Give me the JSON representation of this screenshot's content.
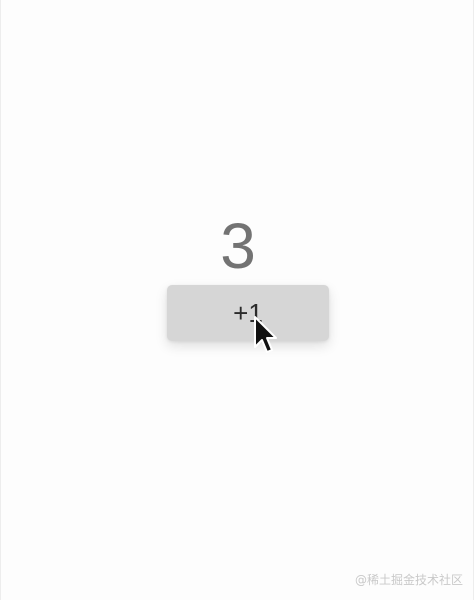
{
  "counter": {
    "value": "3"
  },
  "increment_button": {
    "label": "+1"
  },
  "cursor": {
    "icon": "arrow-pointer-icon"
  },
  "watermark": {
    "text": "@稀土掘金技术社区"
  }
}
